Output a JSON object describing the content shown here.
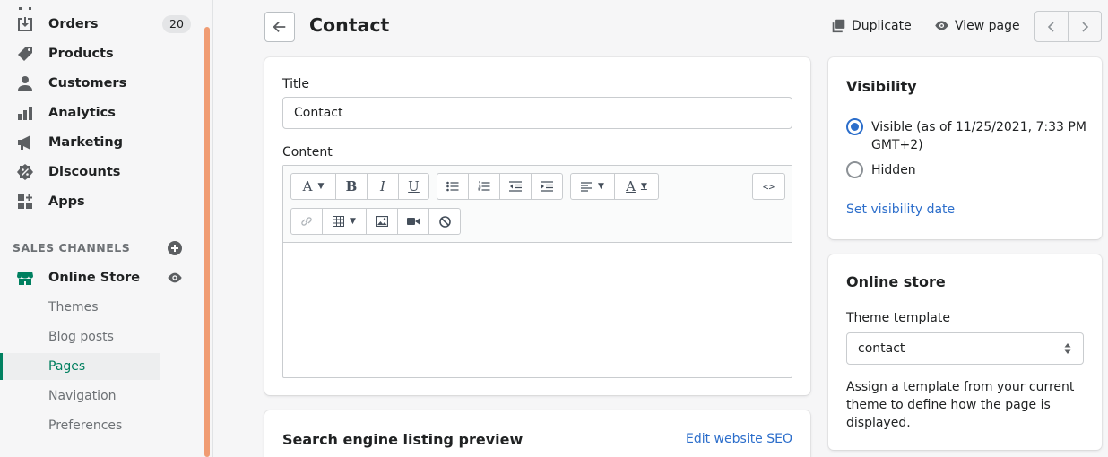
{
  "sidebar": {
    "items": [
      {
        "label": "Orders",
        "badge": "20",
        "icon": "orders-icon"
      },
      {
        "label": "Products",
        "icon": "tag-icon"
      },
      {
        "label": "Customers",
        "icon": "person-icon"
      },
      {
        "label": "Analytics",
        "icon": "bar-chart-icon"
      },
      {
        "label": "Marketing",
        "icon": "megaphone-icon"
      },
      {
        "label": "Discounts",
        "icon": "discount-icon"
      },
      {
        "label": "Apps",
        "icon": "apps-icon"
      }
    ],
    "sales_channels_title": "SALES CHANNELS",
    "online_store": "Online Store",
    "sub_items": [
      "Themes",
      "Blog posts",
      "Pages",
      "Navigation",
      "Preferences"
    ],
    "active_sub_item": "Pages"
  },
  "header": {
    "title": "Contact",
    "duplicate_label": "Duplicate",
    "view_page_label": "View page"
  },
  "main": {
    "title_label": "Title",
    "title_value": "Contact",
    "content_label": "Content",
    "seo_heading": "Search engine listing preview",
    "seo_link": "Edit website SEO"
  },
  "visibility": {
    "heading": "Visibility",
    "visible_label": "Visible (as of 11/25/2021, 7:33 PM GMT+2)",
    "hidden_label": "Hidden",
    "selected": "visible",
    "set_date_link": "Set visibility date"
  },
  "online_store_card": {
    "heading": "Online store",
    "template_label": "Theme template",
    "template_value": "contact",
    "help_text": "Assign a template from your current theme to define how the page is displayed."
  },
  "colors": {
    "accent_green": "#008060",
    "link_blue": "#2c6ecb",
    "scrollbar": "#f09c73"
  }
}
